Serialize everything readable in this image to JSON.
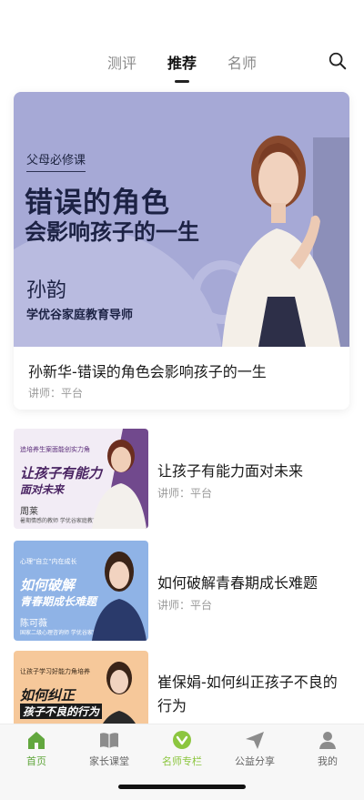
{
  "top_tabs": [
    {
      "label": "测评",
      "active": false
    },
    {
      "label": "推荐",
      "active": true
    },
    {
      "label": "名师",
      "active": false
    }
  ],
  "search_icon": "search-icon",
  "featured": {
    "banner": {
      "tag": "父母必修课",
      "headline_1": "错误的角色",
      "headline_2": "会影响孩子的一生",
      "name": "孙韵",
      "role": "学优谷家庭教育导师",
      "bg_color": "#a6a9d6"
    },
    "title": "孙新华-错误的角色会影响孩子的一生",
    "meta": "讲师：平台"
  },
  "courses": [
    {
      "thumb": {
        "caption": "追培养生案面能创实力角",
        "line1": "让孩子有能力",
        "line2": "面对未来",
        "name": "周莱",
        "roles": "暑期情感的教师 学优谷家庭教育导师",
        "bg": "#f2ecf5",
        "accent": "#5b2d7a"
      },
      "title": "让孩子有能力面对未来",
      "meta": "讲师：平台"
    },
    {
      "thumb": {
        "caption": "心理\"自立\"内在成长",
        "line1": "如何破解",
        "line2": "青春期成长难题",
        "name": "陈可薇",
        "roles": "国家二级心理咨询师 学优谷家庭教育导师",
        "bg": "#8fb3e6",
        "accent": "#ffffff"
      },
      "title": "如何破解青春期成长难题",
      "meta": "讲师：平台"
    },
    {
      "thumb": {
        "caption": "让孩子学习好能力角培养",
        "line1": "如何纠正",
        "line2": "孩子不良的行为",
        "name": "",
        "roles": "",
        "bg": "#f6c89a",
        "accent": "#1a1a1a"
      },
      "title": "崔保娟-如何纠正孩子不良的行为",
      "meta": ""
    }
  ],
  "bottom_nav": [
    {
      "label": "首页",
      "icon": "home-icon",
      "active": true
    },
    {
      "label": "家长课堂",
      "icon": "book-icon",
      "active": false
    },
    {
      "label": "名师专栏",
      "icon": "heart-badge-icon",
      "active": false
    },
    {
      "label": "公益分享",
      "icon": "send-icon",
      "active": false
    },
    {
      "label": "我的",
      "icon": "profile-icon",
      "active": false
    }
  ],
  "colors": {
    "accent_green": "#62a73e",
    "muted_text": "#9a9a9a"
  }
}
